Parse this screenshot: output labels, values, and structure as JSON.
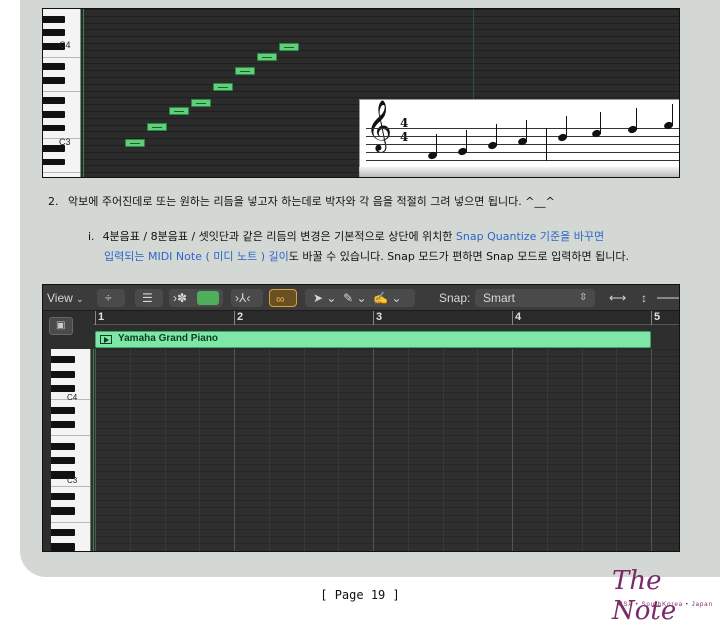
{
  "step2": {
    "number": "2.",
    "text": "악보에 주어진데로 또는 원하는 리듬을 넣고자 하는데로 박자와 각 음을 적절히 그려 넣으면 됩니다. ^__^"
  },
  "substep_i": {
    "marker": "i.",
    "line1_text": "4분음표 / 8분음표 / 셋잇단과 같은 리듬의 변경은 기본적으로 상단에 위치한 ",
    "line1_link": "Snap Quantize 기준을 바꾸면",
    "line2_link": "입력되는 MIDI Note ( 미디 노트 ) 길이",
    "line2_text": "도 바꿀 수 있습니다. Snap 모드가 편하면 Snap 모드로 입력하면 됩니다."
  },
  "top_roll": {
    "key_labels": [
      "C4",
      "C3"
    ]
  },
  "score": {
    "clef": "𝄞",
    "time_top": "4",
    "time_bottom": "4"
  },
  "logic": {
    "view_label": "View",
    "snap_label": "Snap:",
    "snap_value": "Smart",
    "ruler": [
      "1",
      "2",
      "3",
      "4",
      "5"
    ],
    "region_name": "Yamaha Grand Piano",
    "key_labels": [
      "C4",
      "C3"
    ]
  },
  "footer": {
    "page_label": "[ Page 19 ]"
  },
  "logo": {
    "title": "The Note",
    "subtitle": "USA • SouthKorea • Japan"
  },
  "colors": {
    "accent_blue": "#2c66c9",
    "note_green": "#5fd07a",
    "region_green": "#7ee7a7",
    "logo_purple": "#7a2a66"
  }
}
